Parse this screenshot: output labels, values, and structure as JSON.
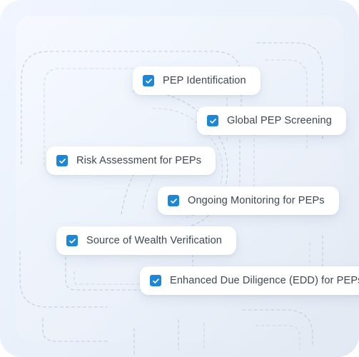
{
  "panel": {
    "background_top_left": "#f0f5ff",
    "background_bottom_right": "#e2e9f3",
    "corner_radius_px": 30,
    "decoration": "dashed-rounded-path-maze",
    "decoration_color": "#bcc7d8"
  },
  "theme": {
    "checkbox_color": "#1d86d6",
    "checkmark_color": "#ffffff",
    "card_background": "#ffffff",
    "label_color": "#3f4753"
  },
  "checklist": {
    "items": [
      {
        "label": "PEP Identification",
        "checked": true,
        "icon": "checkbox-checked-icon"
      },
      {
        "label": "Global PEP Screening",
        "checked": true,
        "icon": "checkbox-checked-icon"
      },
      {
        "label": "Risk Assessment for PEPs",
        "checked": true,
        "icon": "checkbox-checked-icon"
      },
      {
        "label": "Ongoing Monitoring for PEPs",
        "checked": true,
        "icon": "checkbox-checked-icon"
      },
      {
        "label": "Source of Wealth Verification",
        "checked": true,
        "icon": "checkbox-checked-icon"
      },
      {
        "label": "Enhanced Due Diligence (EDD) for PEPs",
        "checked": true,
        "icon": "checkbox-checked-icon"
      }
    ]
  }
}
